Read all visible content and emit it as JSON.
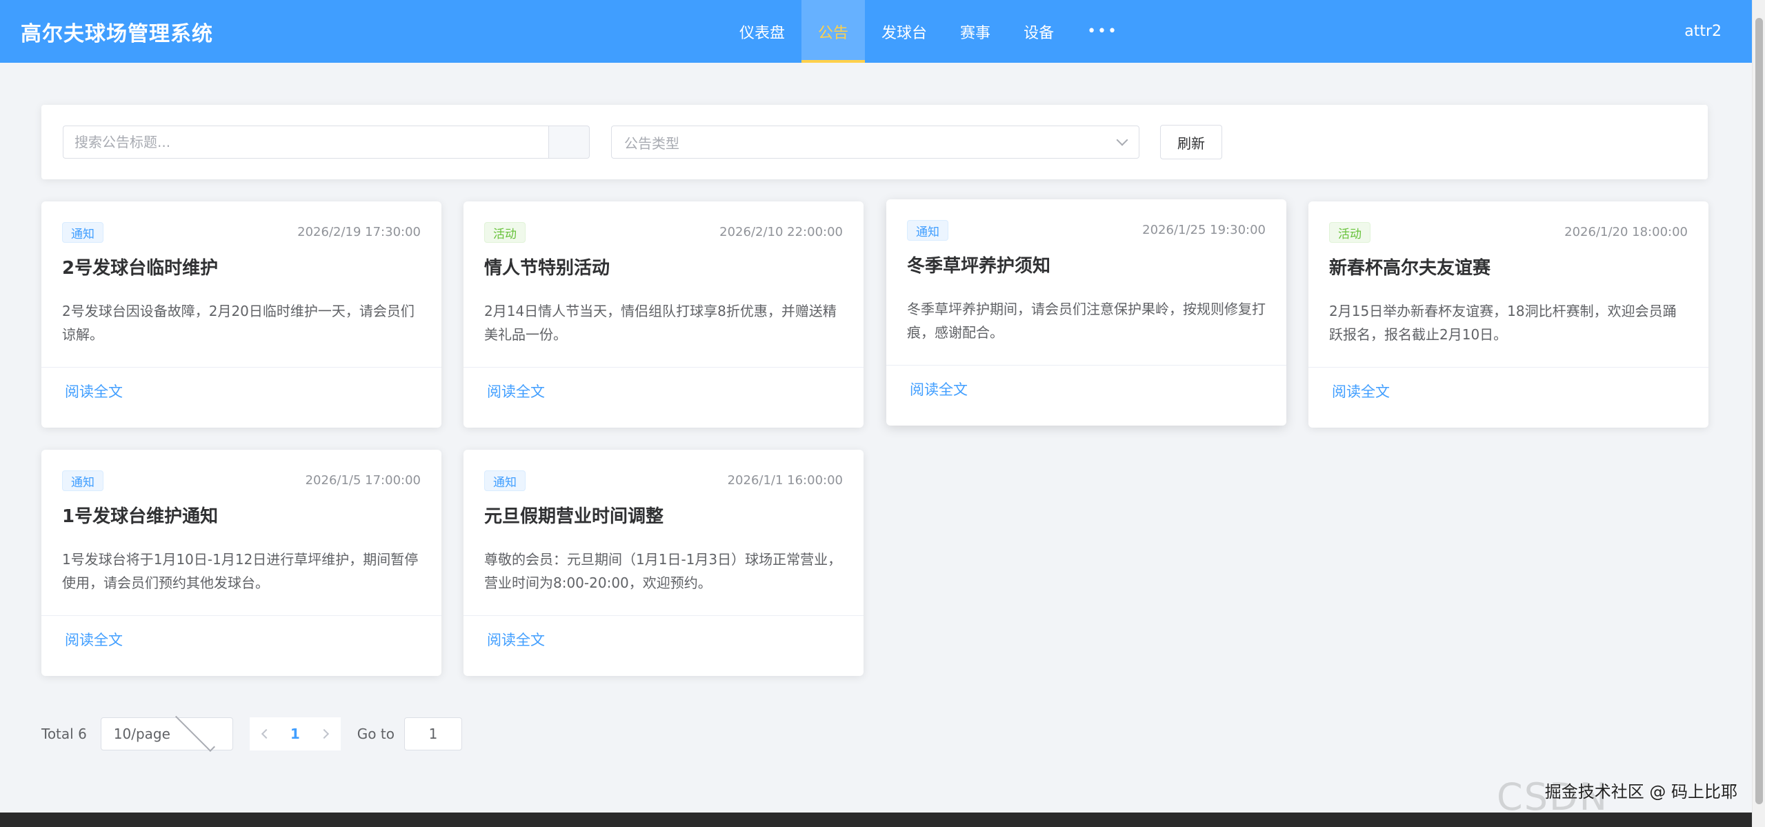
{
  "header": {
    "brand": "高尔夫球场管理系统",
    "nav": [
      {
        "label": "仪表盘",
        "active": false
      },
      {
        "label": "公告",
        "active": true
      },
      {
        "label": "发球台",
        "active": false
      },
      {
        "label": "赛事",
        "active": false
      },
      {
        "label": "设备",
        "active": false
      },
      {
        "label": "•••",
        "active": false
      }
    ],
    "user": "attr2"
  },
  "filter": {
    "search_placeholder": "搜索公告标题...",
    "type_placeholder": "公告类型",
    "refresh_label": "刷新"
  },
  "cards": [
    {
      "tag": "通知",
      "tag_type": "notice",
      "date": "2026/2/19 17:30:00",
      "title": "2号发球台临时维护",
      "desc": "2号发球台因设备故障，2月20日临时维护一天，请会员们谅解。",
      "link": "阅读全文"
    },
    {
      "tag": "活动",
      "tag_type": "activity",
      "date": "2026/2/10 22:00:00",
      "title": "情人节特别活动",
      "desc": "2月14日情人节当天，情侣组队打球享8折优惠，并赠送精美礼品一份。",
      "link": "阅读全文"
    },
    {
      "tag": "通知",
      "tag_type": "notice",
      "date": "2026/1/25 19:30:00",
      "title": "冬季草坪养护须知",
      "desc": "冬季草坪养护期间，请会员们注意保护果岭，按规则修复打痕，感谢配合。",
      "link": "阅读全文"
    },
    {
      "tag": "活动",
      "tag_type": "activity",
      "date": "2026/1/20 18:00:00",
      "title": "新春杯高尔夫友谊赛",
      "desc": "2月15日举办新春杯友谊赛，18洞比杆赛制，欢迎会员踊跃报名，报名截止2月10日。",
      "link": "阅读全文"
    },
    {
      "tag": "通知",
      "tag_type": "notice",
      "date": "2026/1/5 17:00:00",
      "title": "1号发球台维护通知",
      "desc": "1号发球台将于1月10日-1月12日进行草坪维护，期间暂停使用，请会员们预约其他发球台。",
      "link": "阅读全文"
    },
    {
      "tag": "通知",
      "tag_type": "notice",
      "date": "2026/1/1 16:00:00",
      "title": "元旦假期营业时间调整",
      "desc": "尊敬的会员：元旦期间（1月1日-1月3日）球场正常营业，营业时间为8:00-20:00，欢迎预约。",
      "link": "阅读全文"
    }
  ],
  "pagination": {
    "total": "Total 6",
    "page_size": "10/page",
    "current_page": "1",
    "goto_label": "Go to",
    "goto_value": "1"
  },
  "watermark": "掘金技术社区 @ 码上比耶",
  "ghost_watermark": "CSDN @du_001"
}
